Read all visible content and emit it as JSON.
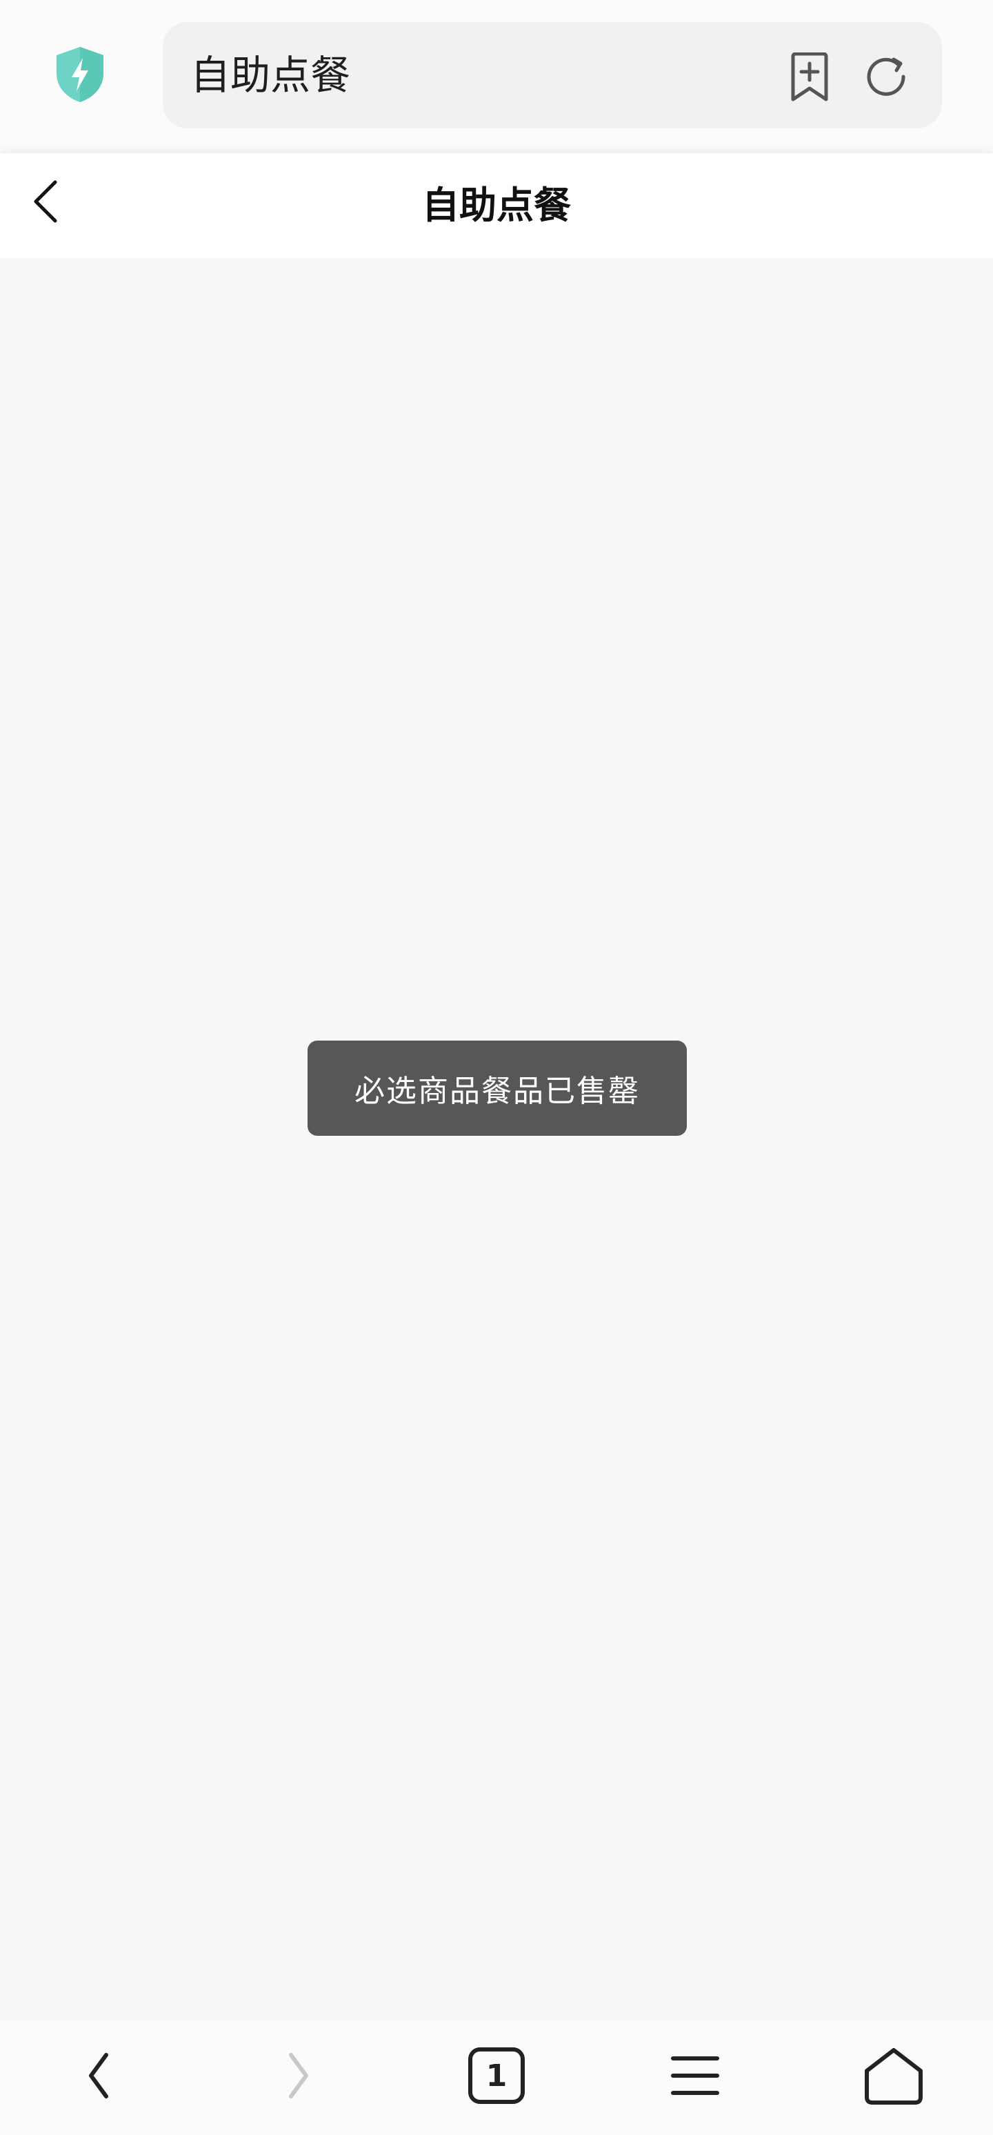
{
  "browser": {
    "address_text": "自助点餐",
    "tab_count": "1",
    "accent_color": "#4fd1bd"
  },
  "header": {
    "title": "自助点餐"
  },
  "toast": {
    "message": "必选商品餐品已售罄"
  },
  "icons": {
    "shield": "shield-lightning-icon",
    "bookmark": "bookmark-add-icon",
    "refresh": "refresh-icon",
    "back": "chevron-left-icon",
    "nav_back": "back-icon",
    "nav_forward": "forward-icon",
    "tabs": "tabs-icon",
    "menu": "menu-icon",
    "home": "home-icon"
  }
}
